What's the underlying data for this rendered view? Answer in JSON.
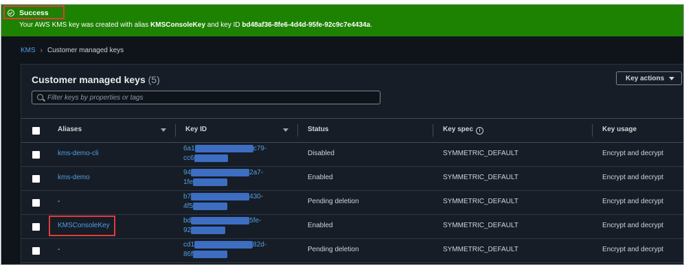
{
  "banner": {
    "title": "Success",
    "msg_prefix": "Your AWS KMS key was created with alias ",
    "alias": "KMSConsoleKey",
    "msg_mid": " and key ID ",
    "key_id": "bd48af36-8fe6-4d4d-95fe-92c9c7e4434a",
    "msg_suffix": "."
  },
  "breadcrumb": {
    "root": "KMS",
    "current": "Customer managed keys"
  },
  "panel": {
    "title": "Customer managed keys",
    "count": "(5)",
    "key_actions_label": "Key actions"
  },
  "search": {
    "placeholder": "Filter keys by properties or tags"
  },
  "columns": {
    "aliases": "Aliases",
    "key_id": "Key ID",
    "status": "Status",
    "key_spec": "Key spec",
    "key_usage": "Key usage"
  },
  "rows": [
    {
      "alias": "kms-demo-cli",
      "key_id_start": "6a1",
      "key_id_mid1": "████████████",
      "key_id_end1": "c79-",
      "key_id_line2_start": "cc6",
      "key_id_mid2": "███████",
      "status": "Disabled",
      "key_spec": "SYMMETRIC_DEFAULT",
      "key_usage": "Encrypt and decrypt"
    },
    {
      "alias": "kms-demo",
      "key_id_start": "94",
      "key_id_mid1": "████████████",
      "key_id_end1": "2a7-",
      "key_id_line2_start": "1fe",
      "key_id_mid2": "███████",
      "status": "Enabled",
      "key_spec": "SYMMETRIC_DEFAULT",
      "key_usage": "Encrypt and decrypt"
    },
    {
      "alias": "-",
      "key_id_start": "b7",
      "key_id_mid1": "████████████",
      "key_id_end1": "430-",
      "key_id_line2_start": "4f5",
      "key_id_mid2": "███████",
      "status": "Pending deletion",
      "key_spec": "SYMMETRIC_DEFAULT",
      "key_usage": "Encrypt and decrypt"
    },
    {
      "alias": "KMSConsoleKey",
      "key_id_start": "bd",
      "key_id_mid1": "████████████",
      "key_id_end1": "5fe-",
      "key_id_line2_start": "92",
      "key_id_mid2": "███████",
      "status": "Enabled",
      "key_spec": "SYMMETRIC_DEFAULT",
      "key_usage": "Encrypt and decrypt"
    },
    {
      "alias": "-",
      "key_id_start": "cd1",
      "key_id_mid1": "████████████",
      "key_id_end1": "82d-",
      "key_id_line2_start": "86f",
      "key_id_mid2": "███████",
      "status": "Pending deletion",
      "key_spec": "SYMMETRIC_DEFAULT",
      "key_usage": "Encrypt and decrypt"
    }
  ],
  "colors": {
    "banner_bg": "#1d8102",
    "link": "#539fe5",
    "panel_bg": "#161d26",
    "page_bg": "#0f141a",
    "highlight": "#e23b3b"
  }
}
